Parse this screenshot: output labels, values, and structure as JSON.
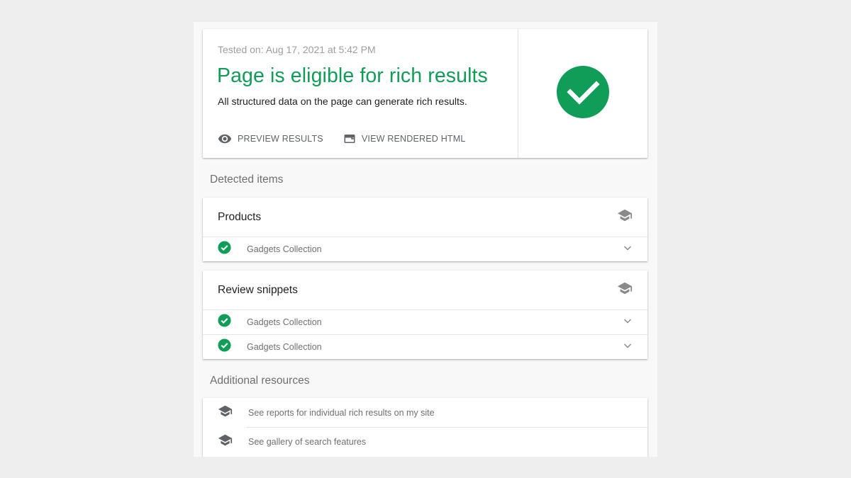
{
  "summary": {
    "tested_on": "Tested on: Aug 17, 2021 at 5:42 PM",
    "headline": "Page is eligible for rich results",
    "subtitle": "All structured data on the page can generate rich results.",
    "actions": [
      {
        "label": "PREVIEW RESULTS",
        "icon": "eye-icon"
      },
      {
        "label": "VIEW RENDERED HTML",
        "icon": "browser-window-icon"
      }
    ],
    "status_icon": "check-circle-icon",
    "status_color": "#0f9d58"
  },
  "detected": {
    "title": "Detected items",
    "groups": [
      {
        "title": "Products",
        "icon": "school-icon",
        "items": [
          {
            "name": "Gadgets Collection",
            "status": "valid"
          }
        ]
      },
      {
        "title": "Review snippets",
        "icon": "school-icon",
        "items": [
          {
            "name": "Gadgets Collection",
            "status": "valid"
          },
          {
            "name": "Gadgets Collection",
            "status": "valid"
          }
        ]
      }
    ]
  },
  "resources": {
    "title": "Additional resources",
    "links": [
      {
        "label": "See reports for individual rich results on my site",
        "icon": "school-icon"
      },
      {
        "label": "See gallery of search features",
        "icon": "school-icon"
      }
    ]
  },
  "colors": {
    "accent_green": "#0f9d58",
    "icon_gray": "#8a8a8a",
    "background": "#eeeeee"
  }
}
